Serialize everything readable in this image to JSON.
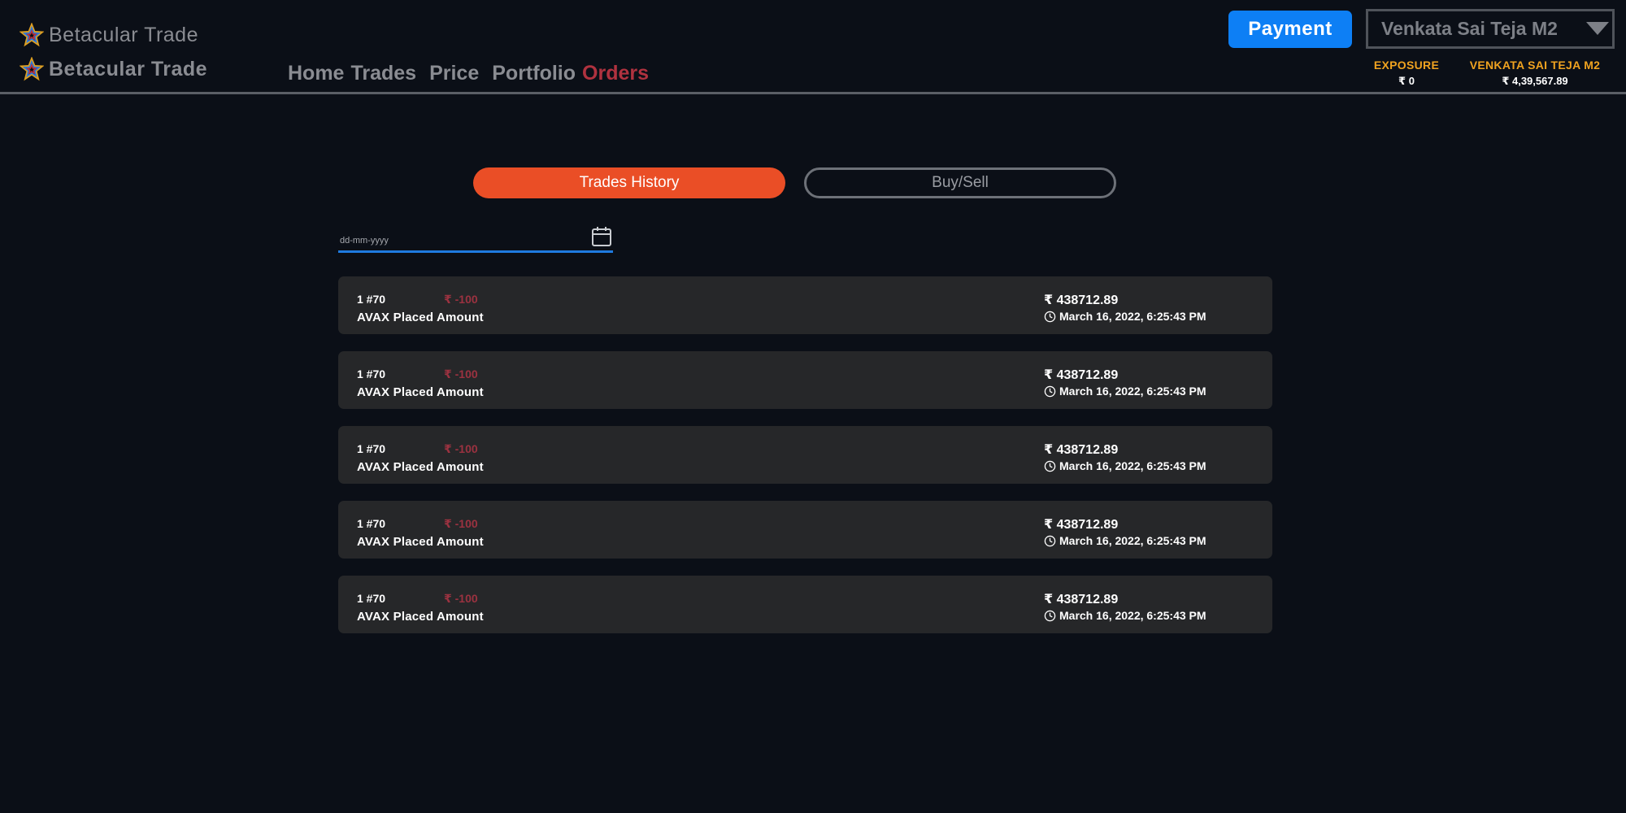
{
  "header": {
    "brand_primary": "Betacular Trade",
    "brand_secondary": "Betacular Trade",
    "nav": [
      {
        "label": "Home",
        "active": false
      },
      {
        "label": "Trades",
        "active": false
      },
      {
        "label": "Price",
        "active": false
      },
      {
        "label": "Portfolio",
        "active": false
      },
      {
        "label": "Orders",
        "active": true
      }
    ],
    "payment_label": "Payment",
    "user_name": "Venkata Sai Teja M2",
    "exposure_label": "EXPOSURE",
    "exposure_value": "₹ 0",
    "balance_label": "VENKATA SAI TEJA M2",
    "balance_value": "₹ 4,39,567.89"
  },
  "tabs": {
    "history": "Trades History",
    "buysell": "Buy/Sell"
  },
  "date_filter": {
    "placeholder": "dd-mm-yyyy",
    "value": ""
  },
  "trades": [
    {
      "qty": "1 #70",
      "delta": "₹ -100",
      "desc": "AVAX Placed Amount",
      "amount": "₹ 438712.89",
      "time": "March 16, 2022, 6:25:43 PM"
    },
    {
      "qty": "1 #70",
      "delta": "₹ -100",
      "desc": "AVAX Placed Amount",
      "amount": "₹ 438712.89",
      "time": "March 16, 2022, 6:25:43 PM"
    },
    {
      "qty": "1 #70",
      "delta": "₹ -100",
      "desc": "AVAX Placed Amount",
      "amount": "₹ 438712.89",
      "time": "March 16, 2022, 6:25:43 PM"
    },
    {
      "qty": "1 #70",
      "delta": "₹ -100",
      "desc": "AVAX Placed Amount",
      "amount": "₹ 438712.89",
      "time": "March 16, 2022, 6:25:43 PM"
    },
    {
      "qty": "1 #70",
      "delta": "₹ -100",
      "desc": "AVAX Placed Amount",
      "amount": "₹ 438712.89",
      "time": "March 16, 2022, 6:25:43 PM"
    }
  ],
  "colors": {
    "background": "#0b0f17",
    "accent_orange": "#ea4e26",
    "payment_blue": "#0d7ff5",
    "nav_active": "#b0323f",
    "negative": "#9b3240",
    "stat_label": "#f0a320",
    "card": "#262729"
  },
  "icons": {
    "brand": "star-logo-icon",
    "calendar": "calendar-icon",
    "clock": "clock-icon",
    "dropdown": "caret-down-icon"
  }
}
